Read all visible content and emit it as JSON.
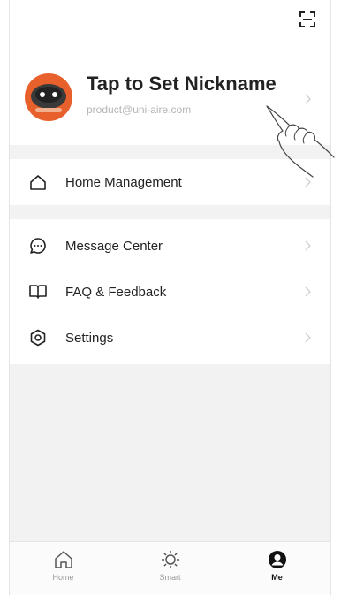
{
  "profile": {
    "nickname": "Tap to Set Nickname",
    "email": "product@uni-aire.com"
  },
  "menu": {
    "home_management": "Home Management",
    "message_center": "Message Center",
    "faq_feedback": "FAQ & Feedback",
    "settings": "Settings"
  },
  "tabs": [
    {
      "label": "Home",
      "icon": "home-icon"
    },
    {
      "label": "Smart",
      "icon": "sun-icon"
    },
    {
      "label": "Me",
      "icon": "user-icon"
    }
  ],
  "colors": {
    "background": "#f2f2f3",
    "avatar": "#e8612c",
    "active_tab": "#111111"
  }
}
